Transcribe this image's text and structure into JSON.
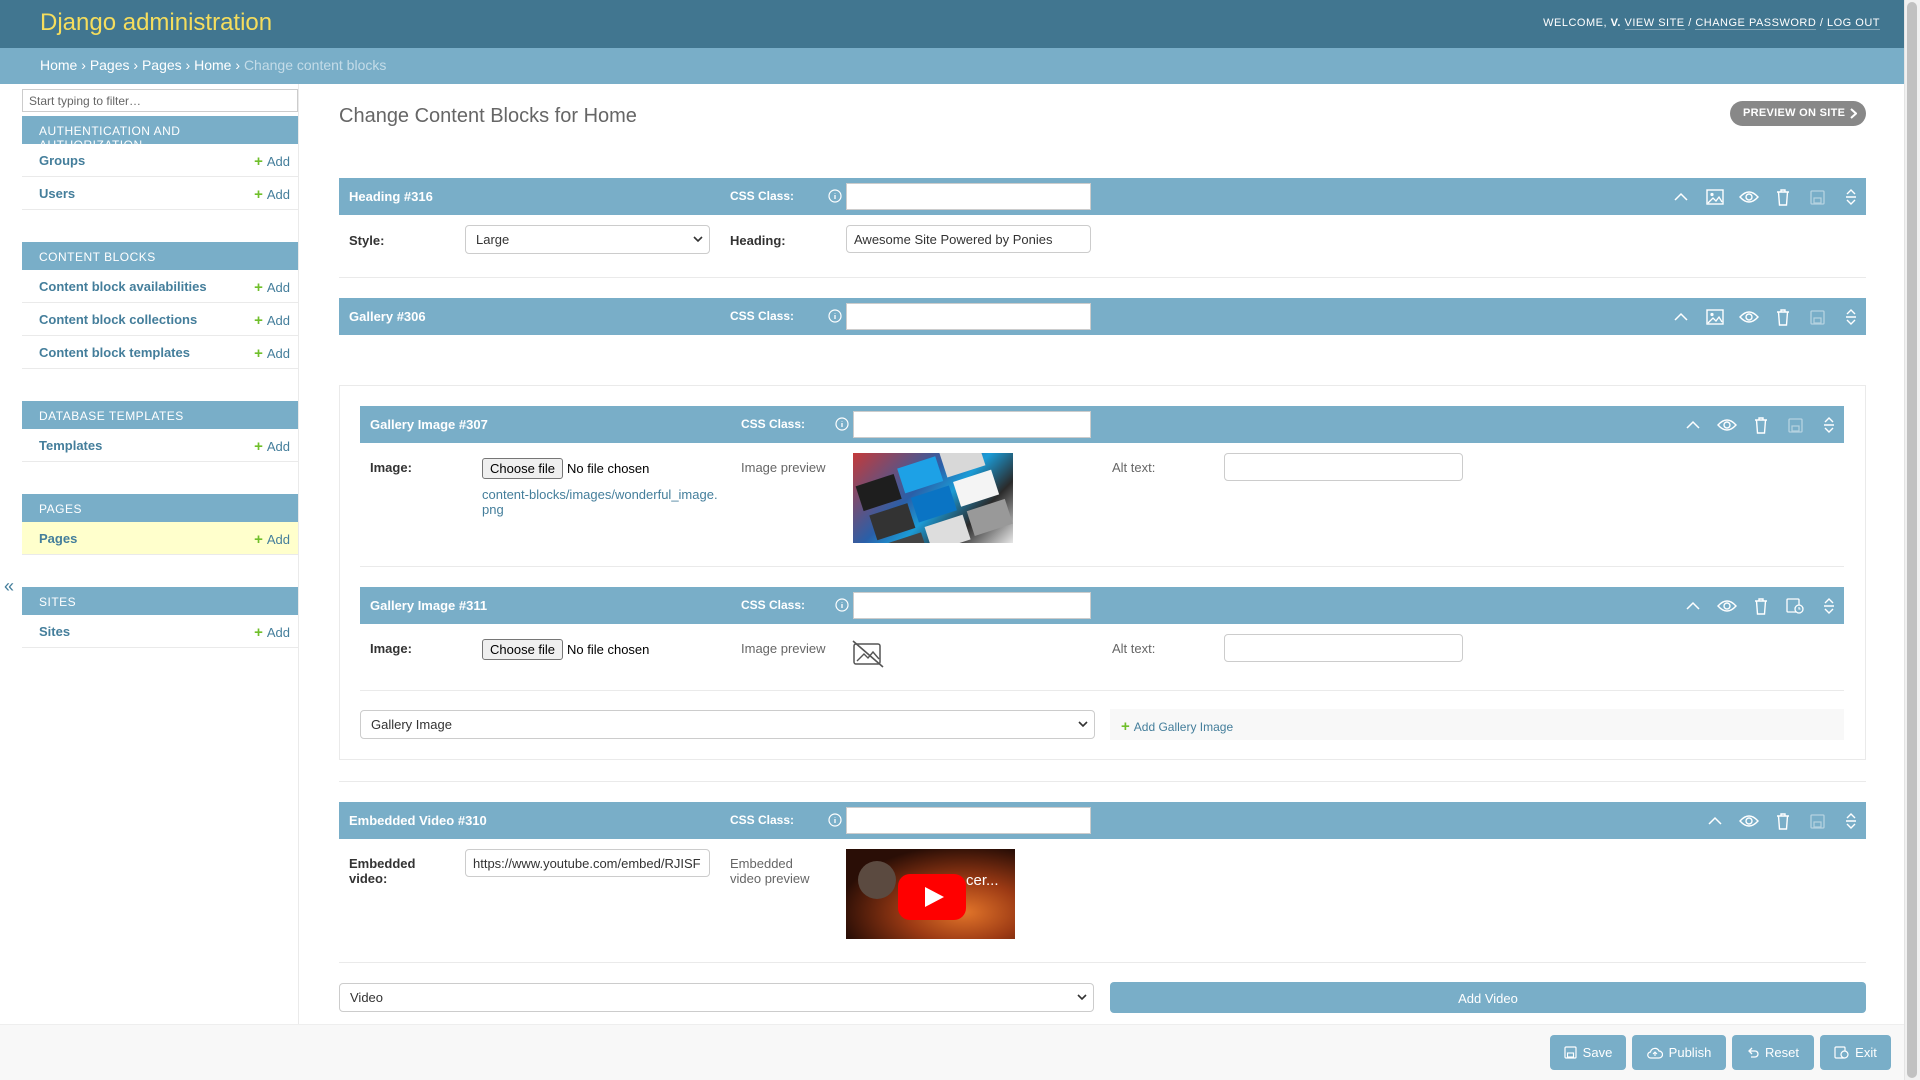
{
  "header": {
    "brand": "Django administration",
    "welcome": "WELCOME,",
    "user": "V.",
    "view_site": "VIEW SITE",
    "change_password": "CHANGE PASSWORD",
    "log_out": "LOG OUT"
  },
  "breadcrumbs": [
    "Home",
    "Pages",
    "Pages",
    "Home",
    "Change content blocks"
  ],
  "sidebar": {
    "filter_placeholder": "Start typing to filter…",
    "add_label": "Add",
    "collapse": "«",
    "apps": [
      {
        "caption": "AUTHENTICATION AND AUTHORIZATION",
        "models": [
          "Groups",
          "Users"
        ]
      },
      {
        "caption": "CONTENT BLOCKS",
        "models": [
          "Content block availabilities",
          "Content block collections",
          "Content block templates"
        ]
      },
      {
        "caption": "DATABASE TEMPLATES",
        "models": [
          "Templates"
        ]
      },
      {
        "caption": "PAGES",
        "models": [
          "Pages"
        ]
      },
      {
        "caption": "SITES",
        "models": [
          "Sites"
        ]
      }
    ]
  },
  "main": {
    "title": "Change Content Blocks for Home",
    "preview_button": "PREVIEW ON SITE",
    "css_class_label": "CSS Class:",
    "heading_block": {
      "title": "Heading #316",
      "style_label": "Style:",
      "style_value": "Large",
      "heading_label": "Heading:",
      "heading_value": "Awesome Site Powered by Ponies"
    },
    "gallery_block": {
      "title": "Gallery #306",
      "images": [
        {
          "title": "Gallery Image #307",
          "image_label": "Image:",
          "choose_file": "Choose file",
          "no_file": "No file chosen",
          "file_path": "content-blocks/images/wonderful_image.png",
          "preview_label": "Image preview",
          "alt_label": "Alt text:"
        },
        {
          "title": "Gallery Image #311",
          "image_label": "Image:",
          "choose_file": "Choose file",
          "no_file": "No file chosen",
          "preview_label": "Image preview",
          "alt_label": "Alt text:"
        }
      ],
      "type_select": "Gallery Image",
      "add_link": "Add Gallery Image"
    },
    "video_block": {
      "title": "Embedded Video #310",
      "label": "Embedded video:",
      "url": "https://www.youtube.com/embed/RJISF",
      "preview_label": "Embedded video preview",
      "video_title": "cer..."
    },
    "bottom_select": "Video",
    "add_video": "Add Video"
  },
  "footer": {
    "save": "Save",
    "publish": "Publish",
    "reset": "Reset",
    "exit": "Exit"
  },
  "colors": {
    "header": "#417690",
    "breadcrumbs": "#79aec8",
    "brand": "#f5dd5d",
    "link": "#447e9b",
    "add_plus": "#70bf2b",
    "current_row": "#ffffcc"
  }
}
